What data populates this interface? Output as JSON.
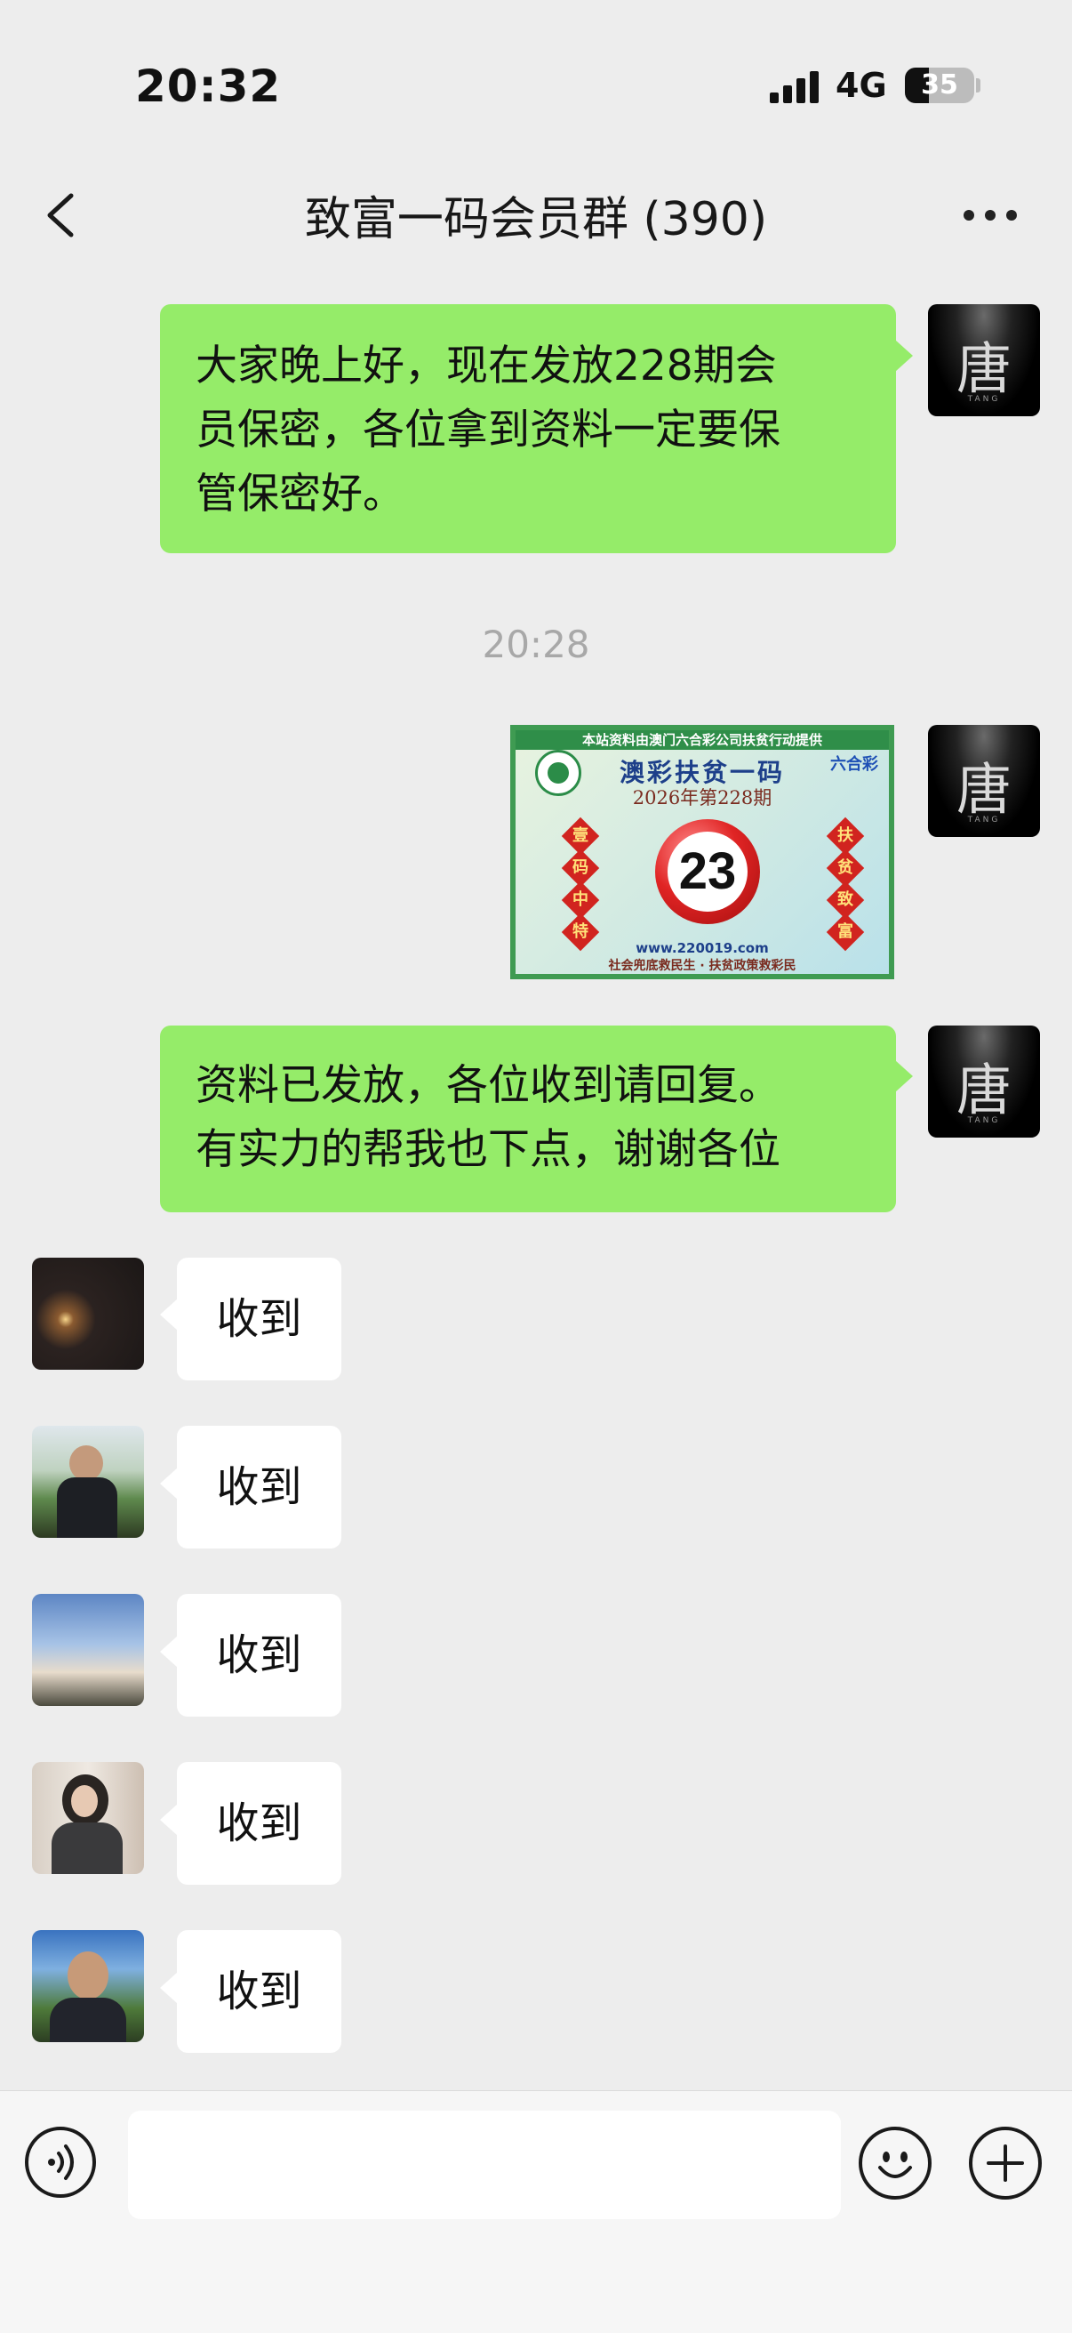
{
  "status_bar": {
    "time": "20:32",
    "network": "4G",
    "battery": "35",
    "battery_level": 0.35
  },
  "header": {
    "title": "致富一码会员群 (390)",
    "back_icon": "chevron-left-icon",
    "more_icon": "more-dots-icon"
  },
  "messages": [
    {
      "side": "right",
      "type": "text",
      "lines": [
        "大家晚上好，现在发放228期会",
        "员保密，各位拿到资料一定要保",
        "管保密好。"
      ]
    },
    {
      "type": "timestamp",
      "text": "20:28"
    },
    {
      "side": "right",
      "type": "image",
      "image": {
        "top_banner": "本站资料由澳门六合彩公司扶贫行动提供",
        "title": "澳彩扶贫一码",
        "issue": "2026年第228期",
        "brand": "六合彩",
        "left_chars": [
          "壹",
          "码",
          "中",
          "特"
        ],
        "right_chars": [
          "扶",
          "贫",
          "致",
          "富"
        ],
        "number": "23",
        "url": "www.220019.com",
        "slogan": "社会兜底救民生 · 扶贫政策救彩民"
      }
    },
    {
      "side": "right",
      "type": "text",
      "lines": [
        "资料已发放，各位收到请回复。",
        "有实力的帮我也下点，谢谢各位"
      ]
    },
    {
      "side": "left",
      "type": "text",
      "text": "收到"
    },
    {
      "side": "left",
      "type": "text",
      "text": "收到"
    },
    {
      "side": "left",
      "type": "text",
      "text": "收到"
    },
    {
      "side": "left",
      "type": "text",
      "text": "收到"
    },
    {
      "side": "left",
      "type": "text",
      "text": "收到"
    }
  ],
  "sender_avatar": {
    "char": "唐",
    "subtitle": "TANG"
  },
  "input_bar": {
    "voice_icon": "voice-icon",
    "emoji_icon": "emoji-icon",
    "plus_icon": "plus-icon",
    "input_value": ""
  },
  "colors": {
    "background": "#ededed",
    "sent_bubble": "#95ec69",
    "received_bubble": "#ffffff"
  }
}
